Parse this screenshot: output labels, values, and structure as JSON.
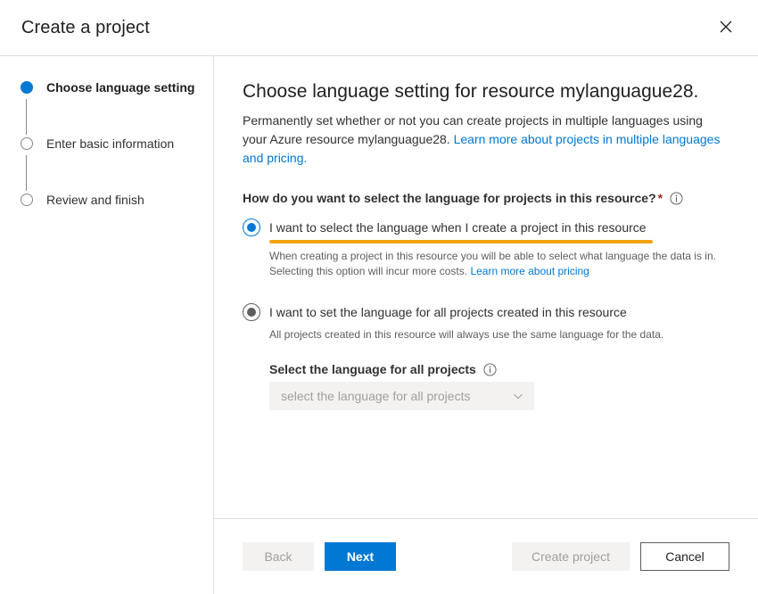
{
  "dialog": {
    "title": "Create a project",
    "close_icon": "close-icon"
  },
  "steps": [
    {
      "label": "Choose language setting",
      "state": "active"
    },
    {
      "label": "Enter basic information",
      "state": "inactive"
    },
    {
      "label": "Review and finish",
      "state": "inactive"
    }
  ],
  "main": {
    "heading": "Choose language setting for resource mylanguague28.",
    "description_part1": "Permanently set whether or not you can create projects in multiple languages using your Azure resource mylanguague28. ",
    "description_link": "Learn more about projects in multiple languages and pricing.",
    "question": "How do you want to select the language for projects in this resource?",
    "required_marker": "*",
    "question_info_icon": "info-icon",
    "options": [
      {
        "label": "I want to select the language when I create a project in this resource",
        "help_text": "When creating a project in this resource you will be able to select what language the data is in. Selecting this option will incur more costs. ",
        "help_link": "Learn more about pricing",
        "state": "selected",
        "highlight_color": "#f2a30f"
      },
      {
        "label": "I want to set the language for all projects created in this resource",
        "help_text": "All projects created in this resource will always use the same language for the data.",
        "state": "pressed"
      }
    ],
    "language_select": {
      "label": "Select the language for all projects",
      "info_icon": "info-icon",
      "placeholder": "select the language for all projects",
      "value": "",
      "disabled": true,
      "chevron_icon": "chevron-down-icon"
    }
  },
  "footer": {
    "back_label": "Back",
    "next_label": "Next",
    "create_label": "Create project",
    "cancel_label": "Cancel"
  },
  "colors": {
    "accent": "#0078d4",
    "highlight": "#f2a30f",
    "required": "#a4262c",
    "divider": "#e1dfdd"
  }
}
